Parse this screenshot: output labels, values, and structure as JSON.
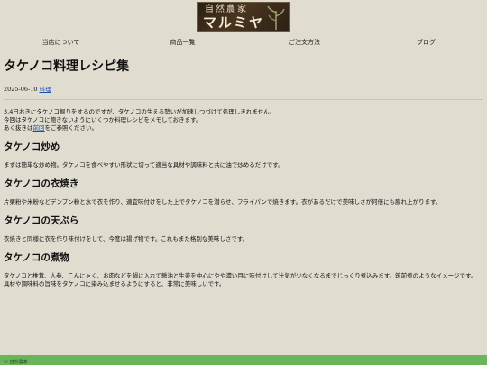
{
  "logo": {
    "line1": "自然農家",
    "line2": "マルミヤ",
    "icon": "bamboo-sprig-icon"
  },
  "nav": {
    "items": [
      "当店について",
      "商品一覧",
      "ご注文方法",
      "ブログ"
    ]
  },
  "article": {
    "title": "タケノコ料理レシピ集",
    "date": "2025-06-10",
    "category": "料理",
    "intro_lines": [
      "3,4日おきにタケノコ掘りをするのですが、タケノコの生える勢いが加速しつづけて処理しきれません。",
      "今回はタケノコに飽きないようにいくつか料理レシピをメモしておきます。"
    ],
    "intro_prefix": "あく抜きは",
    "intro_link": "前回",
    "intro_suffix": "をご参照ください。",
    "sections": [
      {
        "heading": "タケノコ炒め",
        "lines": [
          "まずは簡単な炒め物。タケノコを食べやすい形状に切って適当な具材や調味料と共に油で炒めるだけです。"
        ]
      },
      {
        "heading": "タケノコの衣焼き",
        "lines": [
          "片栗粉や米粉などデンプン粉と水で衣を作り、適宜味付けをした上でタケノコを潜らせ、フライパンで焼きます。衣があるだけで美味しさが何倍にも膨れ上がります。"
        ]
      },
      {
        "heading": "タケノコの天ぷら",
        "lines": [
          "衣焼きと同様に衣を作り味付けをして、今度は揚げ物です。これもまた格別な美味しさです。"
        ]
      },
      {
        "heading": "タケノコの煮物",
        "lines": [
          "タケノコと椎茸、人参、こんにゃく、お肉などを鍋に入れて醤油と生姜を中心にやや濃い目に味付けして汁気が少なくなるまでじっくり煮込みます。筑前煮のようなイメージです。",
          "具材や調味料の旨味をタケノコに染み込ませるようにすると、非常に美味しいです。"
        ]
      }
    ]
  },
  "footer": {
    "text": "© 自然農家"
  },
  "colors": {
    "background": "#e0ddd0",
    "link": "#1a4fb0",
    "footer": "#6ab55a"
  }
}
